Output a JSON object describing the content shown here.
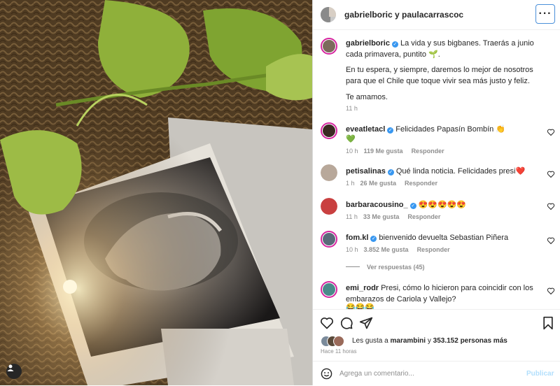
{
  "header": {
    "title": "gabrielboric y paulacarrascoc",
    "more_label": "···"
  },
  "caption": {
    "username": "gabrielboric",
    "text_1": "La vida y sus bigbanes. Traerás a junio cada primavera, puntito 🌱.",
    "text_2": "En tu espera, y siempre, daremos lo mejor de nosotros para que el Chile que toque vivir sea más justo y feliz.",
    "text_3": "Te amamos.",
    "time": "11 h"
  },
  "comments": [
    {
      "username": "eveatletacl",
      "verified": true,
      "text": "Felicidades Papasín Bombín 👏",
      "extra": "💚",
      "time": "10 h",
      "likes": "119 Me gusta",
      "reply": "Responder"
    },
    {
      "username": "petisalinas",
      "verified": true,
      "text": "Qué linda noticia. Felicidades presi❤️",
      "time": "1 h",
      "likes": "26 Me gusta",
      "reply": "Responder"
    },
    {
      "username": "barbaracousino_",
      "verified": true,
      "text": "😍😍😍😍😍",
      "time": "11 h",
      "likes": "33 Me gusta",
      "reply": "Responder"
    },
    {
      "username": "fom.kl",
      "verified": true,
      "text": "bienvenido devuelta Sebastian Piñera",
      "time": "10 h",
      "likes": "3.852 Me gusta",
      "reply": "Responder",
      "view_replies": "Ver respuestas (45)"
    },
    {
      "username": "emi_rodr",
      "verified": false,
      "text": "Presi, cómo lo hicieron para coincidir con los embarazos de Cariola y Vallejo?",
      "extra": "😂😂😂"
    }
  ],
  "likes": {
    "prefix": "Les gusta a",
    "user": "marambini",
    "middle": "y",
    "count": "353.152 personas más",
    "ago": "Hace 11 horas"
  },
  "add_comment": {
    "placeholder": "Agrega un comentario...",
    "post_label": "Publicar"
  },
  "colors": {
    "verified": "#3897f0",
    "ring": "#d6249f",
    "post": "#b2dffc"
  }
}
